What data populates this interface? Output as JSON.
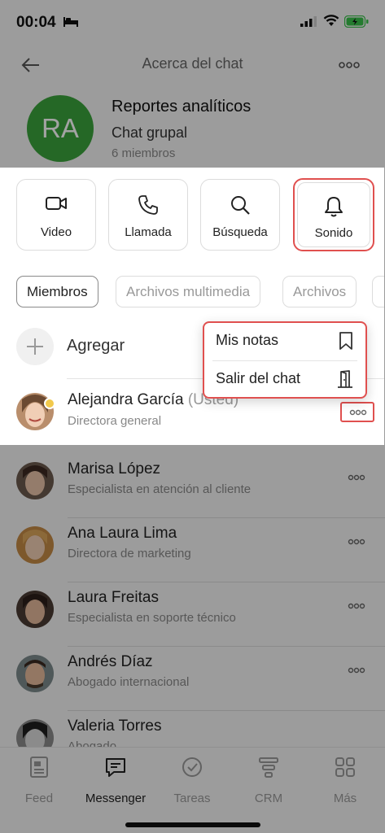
{
  "status": {
    "time": "00:04"
  },
  "header": {
    "title": "Acerca del chat"
  },
  "chat": {
    "avatar_initials": "RA",
    "avatar_color": "#3ba33c",
    "name": "Reportes analíticos",
    "type": "Chat grupal",
    "members": "6 miembros"
  },
  "actions": [
    {
      "label": "Video",
      "icon": "video-icon"
    },
    {
      "label": "Llamada",
      "icon": "phone-icon"
    },
    {
      "label": "Búsqueda",
      "icon": "search-icon"
    },
    {
      "label": "Sonido",
      "icon": "bell-icon"
    }
  ],
  "tabs": [
    "Miembros",
    "Archivos multimedia",
    "Archivos"
  ],
  "add": {
    "label": "Agregar"
  },
  "popup": [
    {
      "label": "Mis notas",
      "icon": "bookmark-icon"
    },
    {
      "label": "Salir del chat",
      "icon": "exit-door-icon"
    }
  ],
  "members": [
    {
      "name": "Alejandra García",
      "suffix": "(Usted)",
      "role": "Directora general"
    },
    {
      "name": "Marisa López",
      "suffix": "",
      "role": "Especialista en atención al cliente"
    },
    {
      "name": "Ana Laura Lima",
      "suffix": "",
      "role": "Directora de marketing"
    },
    {
      "name": "Laura Freitas",
      "suffix": "",
      "role": "Especialista en soporte técnico"
    },
    {
      "name": "Andrés Díaz",
      "suffix": "",
      "role": "Abogado internacional"
    },
    {
      "name": "Valeria Torres",
      "suffix": "",
      "role": "Abogado"
    }
  ],
  "nav": [
    {
      "label": "Feed",
      "icon": "feed-icon"
    },
    {
      "label": "Messenger",
      "icon": "chat-bubble-icon"
    },
    {
      "label": "Tareas",
      "icon": "check-circle-icon"
    },
    {
      "label": "CRM",
      "icon": "filter-icon"
    },
    {
      "label": "Más",
      "icon": "grid-icon"
    }
  ],
  "colors": {
    "highlight": "#e0504f",
    "accent_green": "#3ba33c",
    "battery": "#39c04a"
  }
}
